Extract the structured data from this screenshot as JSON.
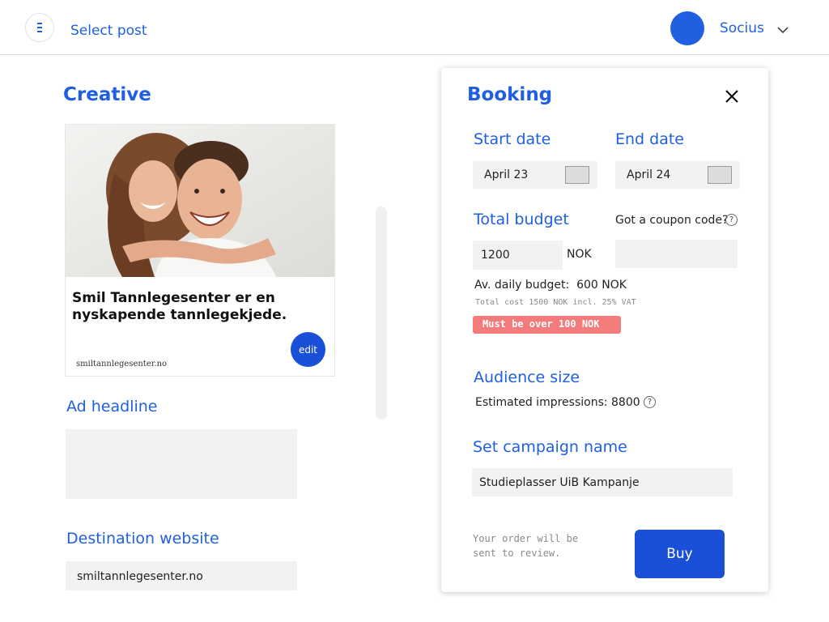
{
  "header": {
    "menu_icon": "hamburger-menu-icon",
    "select_post_label": "Select post",
    "user_name": "Socius",
    "chevron_icon": "chevron-down-icon"
  },
  "creative": {
    "title": "Creative",
    "ad_text": "Smil Tannlegesenter er en nyskapende tannlegekjede.",
    "ad_url": "smiltannlegesenter.no",
    "edit_label": "edit",
    "ad_headline_label": "Ad headline",
    "ad_headline_value": "",
    "destination_label": "Destination website",
    "destination_value": "smiltannlegesenter.no"
  },
  "booking": {
    "title": "Booking",
    "close_icon": "close-icon",
    "start_date_label": "Start date",
    "start_date_value": "April 23",
    "end_date_label": "End date",
    "end_date_value": "April 24",
    "total_budget_label": "Total budget",
    "total_budget_value": "1200",
    "currency": "NOK",
    "coupon_label": "Got a coupon code?",
    "coupon_value": "",
    "daily_budget_label": "Av. daily budget:",
    "daily_budget_value": "600 NOK",
    "total_cost_note": "Total cost 1500 NOK incl. 25% VAT",
    "warning": "Must be over 100 NOK",
    "audience_label": "Audience size",
    "impressions_text": "Estimated impressions: 8800",
    "campaign_label": "Set campaign name",
    "campaign_value": "Studieplasser UiB Kampanje",
    "review_note": "Your order will be sent to review.",
    "buy_label": "Buy",
    "help_symbol": "?"
  },
  "colors": {
    "accent": "#1f5fe0",
    "button": "#1a4fd8",
    "warning": "#f47b7b",
    "field_bg": "#f2f2f2"
  }
}
